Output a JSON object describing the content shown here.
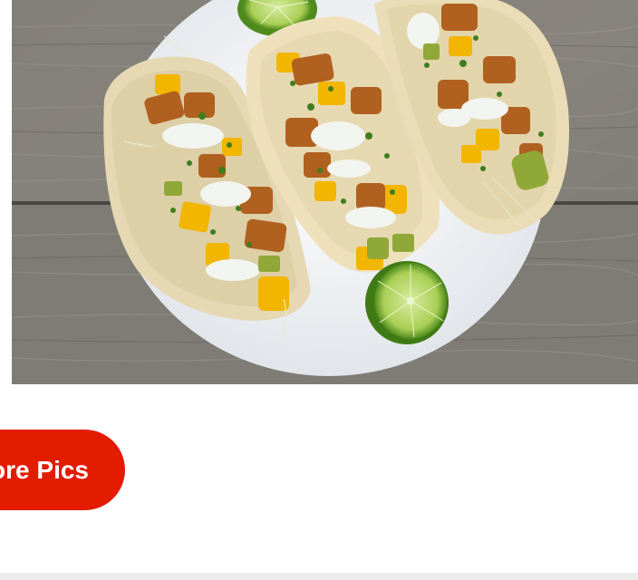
{
  "photo": {
    "subject": "fish-tacos-photo",
    "colors": {
      "wood": "#7d7a74",
      "plate": "#f3f4f6",
      "tortilla": "#e6d6ad",
      "mango": "#f2b500",
      "avocado": "#8fa838",
      "fish": "#b0601f",
      "lime": "#a8d05a"
    }
  },
  "more_pics_button": {
    "label": "More Pics",
    "color": "#e31c00",
    "text_color": "#ffffff"
  }
}
